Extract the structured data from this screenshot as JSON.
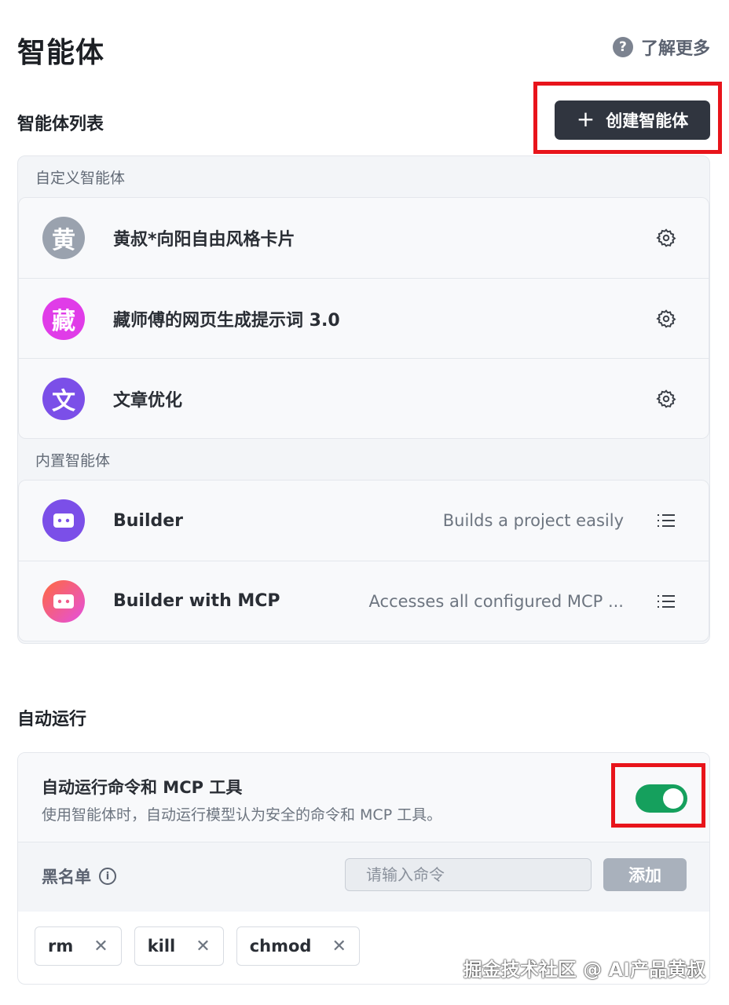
{
  "header": {
    "title": "智能体",
    "learn_more": "了解更多"
  },
  "agents": {
    "list_title": "智能体列表",
    "create_button": "创建智能体",
    "custom_label": "自定义智能体",
    "custom_items": [
      {
        "avatar": "黄",
        "avatar_color": "#9aa2ae",
        "name": "黄叔*向阳自由风格卡片"
      },
      {
        "avatar": "藏",
        "avatar_color": "#e03ce8",
        "name": "藏师傅的网页生成提示词 3.0"
      },
      {
        "avatar": "文",
        "avatar_color": "#7b4fe8",
        "name": "文章优化"
      }
    ],
    "builtin_label": "内置智能体",
    "builtin_items": [
      {
        "name": "Builder",
        "description": "Builds a project easily"
      },
      {
        "name": "Builder with MCP",
        "description": "Accesses all configured MCP ..."
      }
    ]
  },
  "auto_run": {
    "section_title": "自动运行",
    "title": "自动运行命令和 MCP 工具",
    "subtitle": "使用智能体时，自动运行模型认为安全的命令和 MCP 工具。",
    "enabled": true,
    "blacklist_label": "黑名单",
    "input_placeholder": "请输入命令",
    "add_button": "添加",
    "tags": [
      "rm",
      "kill",
      "chmod"
    ]
  },
  "watermark": "掘金技术社区 @ AI产品黄叔",
  "colors": {
    "accent_dark": "#30353f",
    "toggle_on": "#15a05d",
    "highlight_red": "#e8141b"
  }
}
